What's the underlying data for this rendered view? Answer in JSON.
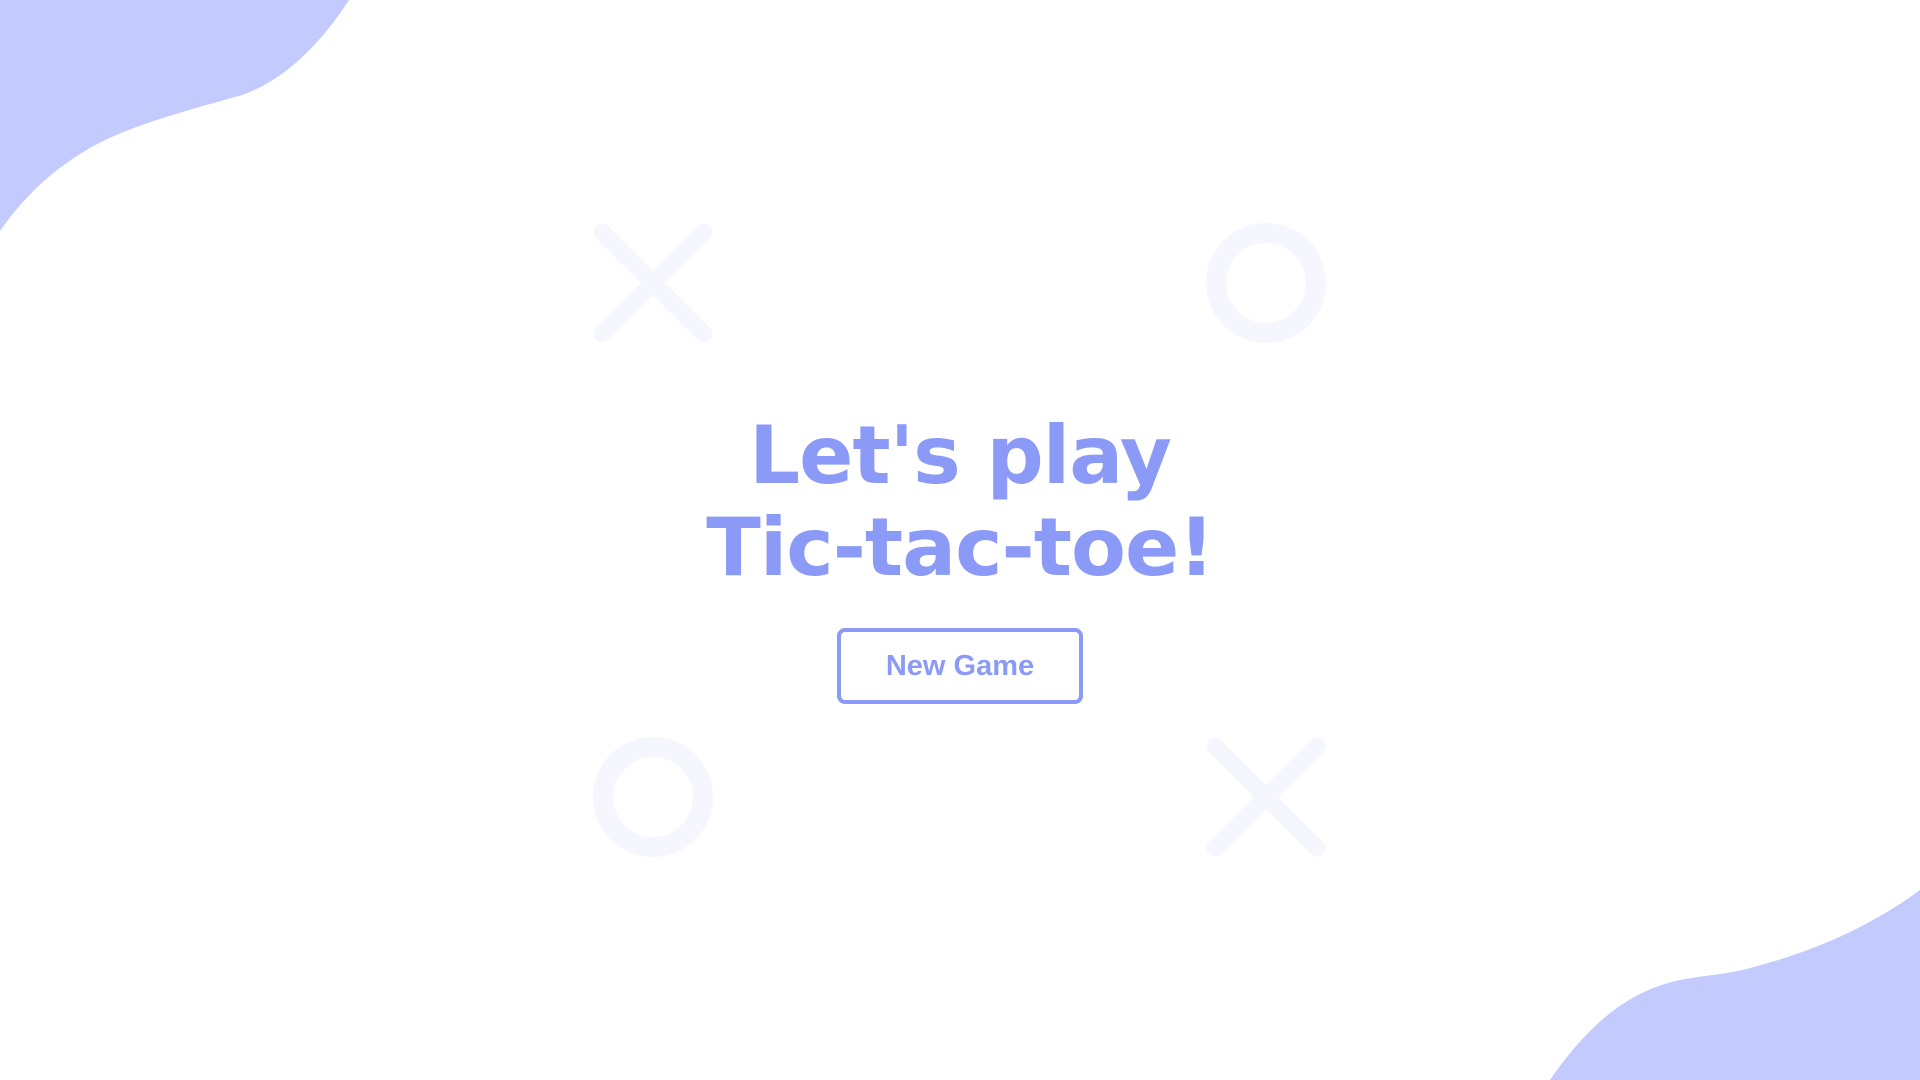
{
  "colors": {
    "accent": "#8b9af7",
    "blob": "#c3cafd",
    "decor": "#f5f6fe",
    "background": "#ffffff"
  },
  "hero": {
    "title_line1": "Let's play",
    "title_line2": "Tic-tac-toe!",
    "button_label": "New Game"
  },
  "decorations": {
    "icons": [
      "x-icon",
      "o-icon",
      "o-icon",
      "x-icon"
    ]
  }
}
